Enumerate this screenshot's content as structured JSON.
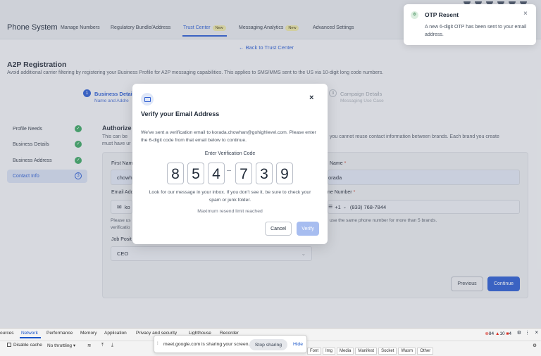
{
  "topnav": {
    "app_title": "Phone System",
    "items": [
      {
        "label": "Manage Numbers"
      },
      {
        "label": "Regulatory Bundle/Address"
      },
      {
        "label": "Trust Center",
        "badge": "New"
      },
      {
        "label": "Messaging Analytics",
        "badge": "New"
      },
      {
        "label": "Advanced Settings"
      }
    ]
  },
  "back_link": "← Back to Trust Center",
  "page": {
    "title": "A2P Registration",
    "subtitle": "Avoid additional carrier filtering by registering your Business Profile for A2P messaging capabilities. This applies to SMS/MMS sent to the US via 10-digit long code numbers."
  },
  "stepper": {
    "step1_number": "1",
    "step1_label": "Business Detai",
    "step1_sub": "Name and Addre",
    "step3_number": "3",
    "step3_label": "Campaign Details",
    "step3_sub": "Messaging Use Case"
  },
  "sidebar": {
    "items": [
      {
        "label": "Profile Needs",
        "status": "✓"
      },
      {
        "label": "Business Details",
        "status": "✓"
      },
      {
        "label": "Business Address",
        "status": "✓"
      },
      {
        "label": "Contact Info",
        "status": "3"
      }
    ]
  },
  "auth": {
    "title": "Authorize",
    "text1": "This can be",
    "text2": "must have ur",
    "text_right": "you cannot reuse contact information between brands. Each brand you create"
  },
  "form": {
    "first_name_label": "First Nam",
    "first_name_value": "chowh",
    "last_name_label": "Name",
    "last_name_required": "*",
    "last_name_value": "orada",
    "email_label": "Email Add",
    "email_value": "ko",
    "phone_label": "ne Number",
    "phone_required": "*",
    "phone_prefix": "+1",
    "phone_value": "(833) 768-7844",
    "hint_left1": "Please us",
    "hint_left2": "verificatio",
    "hint_right": "use the same phone number for more than 5 brands.",
    "job_label": "Job Posit",
    "job_value": "CEO",
    "prev_button": "Previous",
    "continue_button": "Continue"
  },
  "toast": {
    "title": "OTP Resent",
    "close": "×",
    "message": "A new 6-digit OTP has been sent to your email address."
  },
  "modal": {
    "close": "×",
    "title": "Verify your Email Address",
    "description": "We've sent a verification email to korada.chowhan@gohighlevel.com. Please enter the 6-digit code from that email below to continue.",
    "code_label": "Enter Verification Code",
    "digits": [
      "8",
      "5",
      "4",
      "7",
      "3",
      "9"
    ],
    "check_inbox": "Look for our message in your inbox. If you don't see it, be sure to check your spam or junk folder.",
    "max_resend": "Maximum resend limit reached",
    "cancel_button": "Cancel",
    "verify_button": "Verify"
  },
  "devtools": {
    "tabs": [
      "ources",
      "Network",
      "Performance",
      "Memory",
      "Application",
      "Privacy and security",
      "Lighthouse",
      "Recorder"
    ],
    "row2": {
      "disable_cache": "Disable cache",
      "throttling": "No throttling"
    },
    "counts": {
      "errors": "84",
      "warnings": "10",
      "messages": "4"
    },
    "filters": [
      "Font",
      "Img",
      "Media",
      "Manifest",
      "Socket",
      "Wasm",
      "Other"
    ]
  },
  "sharebar": {
    "text": "meet.google.com is sharing your screen.",
    "stop": "Stop sharing",
    "hide": "Hide"
  },
  "colors": {
    "accent": "#2f5fd1",
    "success": "#3fa567",
    "verify_disabled": "#a7bdf0"
  }
}
